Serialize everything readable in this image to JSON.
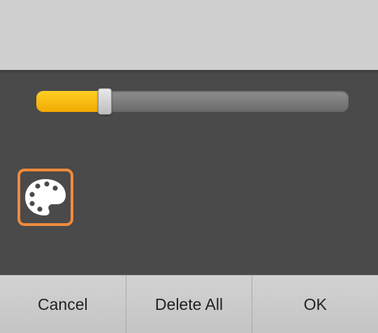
{
  "slider": {
    "value_fraction": 0.22
  },
  "tool": {
    "icon": "palette-icon",
    "border_color": "#f08a3c"
  },
  "buttons": {
    "cancel": "Cancel",
    "delete_all": "Delete All",
    "ok": "OK"
  },
  "colors": {
    "accent": "#f2b300",
    "background": "#4a4a4a",
    "top_area": "#cfcfcf"
  }
}
